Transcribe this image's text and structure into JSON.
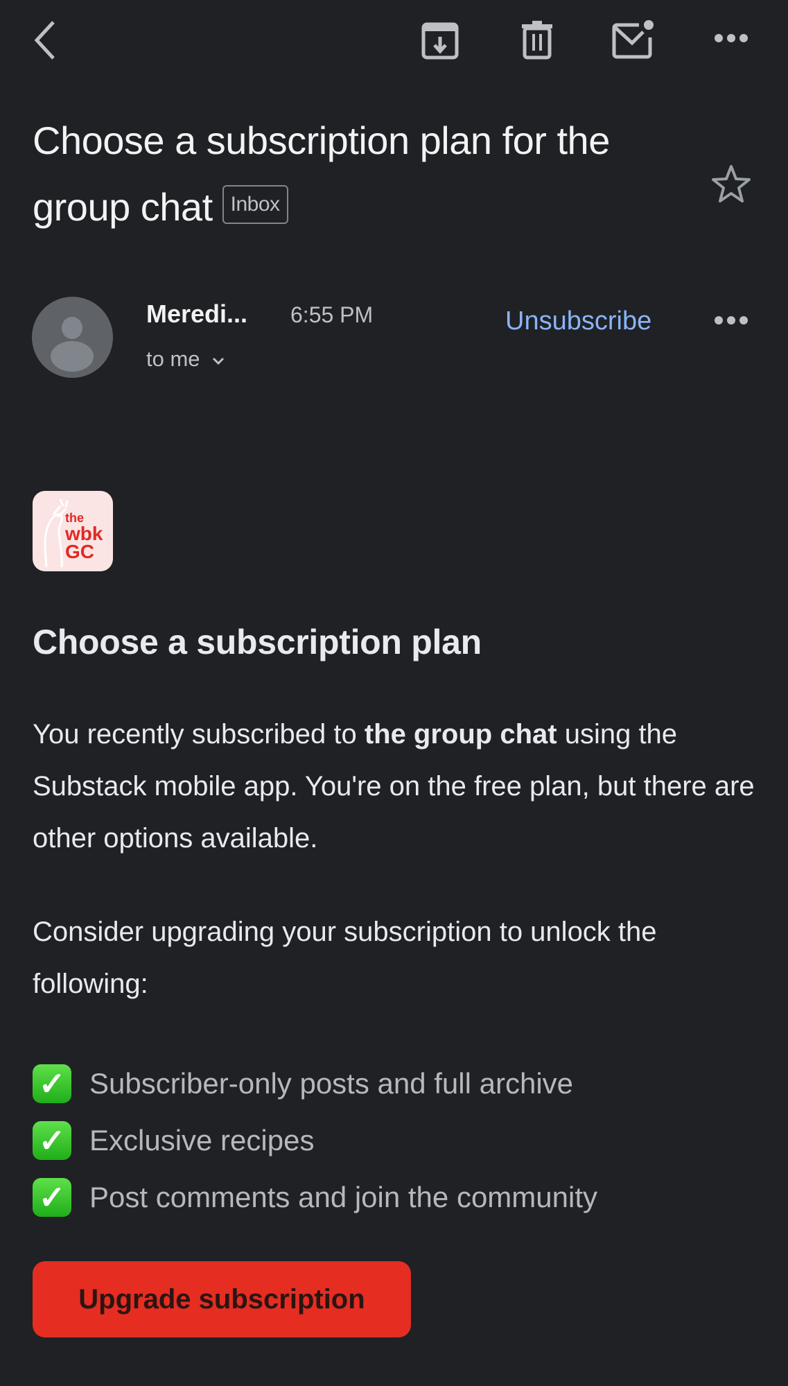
{
  "toolbar": {
    "back_icon": "chevron-left-icon",
    "actions": [
      {
        "name": "archive",
        "icon": "archive-icon"
      },
      {
        "name": "delete",
        "icon": "trash-icon"
      },
      {
        "name": "mark-unread",
        "icon": "mail-unread-icon"
      },
      {
        "name": "more",
        "icon": "more-horizontal-icon"
      }
    ]
  },
  "email": {
    "subject": "Choose a subscription plan for the group chat",
    "label_chip": "Inbox",
    "starred": false,
    "sender": {
      "name": "Meredi...",
      "time": "6:55 PM",
      "recipient": "to me",
      "unsubscribe_label": "Unsubscribe"
    }
  },
  "body": {
    "logo": {
      "line1": "the",
      "line2": "wbk",
      "line3": "GC"
    },
    "heading": "Choose a subscription plan",
    "para1_prefix": "You recently subscribed to ",
    "para1_bold": "the group chat",
    "para1_suffix": " using the Substack mobile app. You're on the free plan, but there are other options available.",
    "para2": "Consider upgrading your subscription to unlock the following:",
    "features": [
      "Subscriber-only posts and full archive",
      "Exclusive recipes",
      "Post comments and join the community"
    ],
    "check_glyph": "✓",
    "cta_label": "Upgrade subscription"
  },
  "colors": {
    "background": "#202124",
    "link": "#8ab4f8",
    "cta": "#e52d22",
    "check": "#2ec22a"
  }
}
